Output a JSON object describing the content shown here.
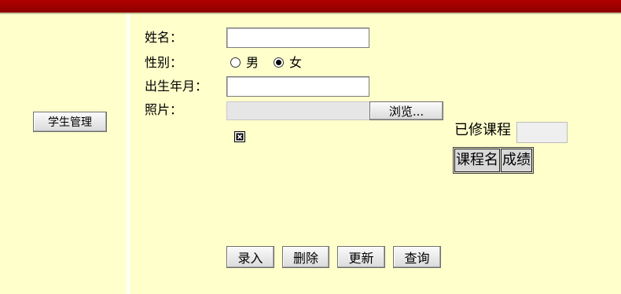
{
  "sidebar": {
    "student_mgmt_button": "学生管理"
  },
  "form": {
    "name_label": "姓名：",
    "name_value": "",
    "gender_label": "性别：",
    "gender_options": [
      "男",
      "女"
    ],
    "gender_selected": "女",
    "birth_label": "出生年月：",
    "birth_value": "",
    "photo_label": "照片：",
    "photo_path": "",
    "browse_button": "浏览...",
    "photo_preview_icon": "broken-image-icon"
  },
  "courses": {
    "completed_label": "已修课程",
    "completed_value": "",
    "headers": [
      "课程名",
      "成绩"
    ]
  },
  "actions": {
    "enter": "录入",
    "delete": "删除",
    "update": "更新",
    "query": "查询"
  },
  "colors": {
    "background": "#ffffcc",
    "header_bar": "#b00000"
  }
}
